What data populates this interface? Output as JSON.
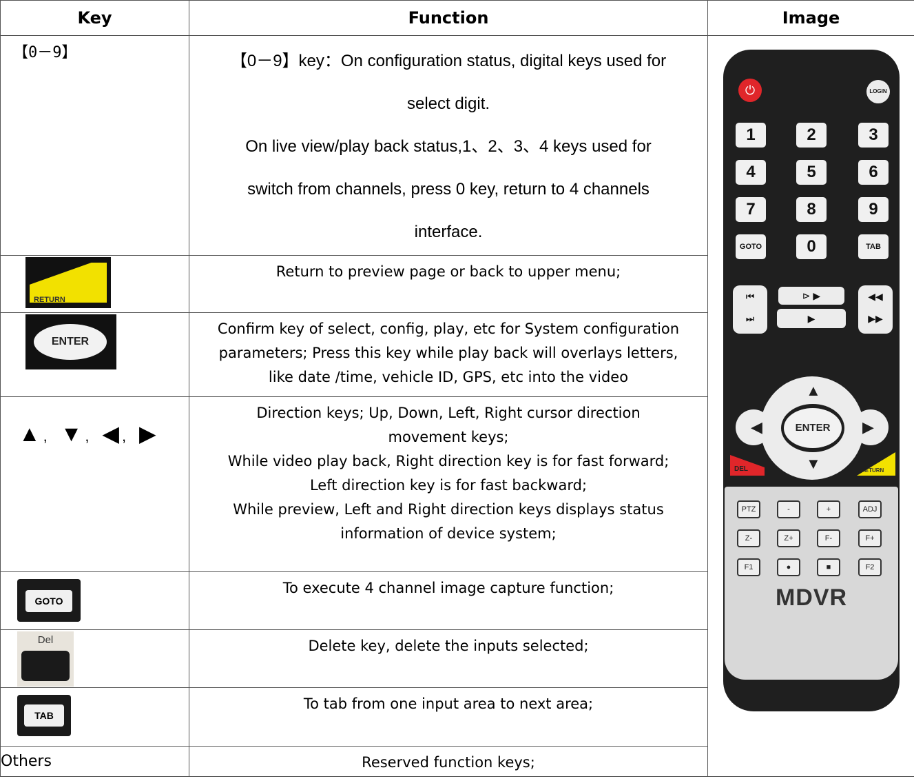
{
  "headers": {
    "key": "Key",
    "function": "Function",
    "image": "Image"
  },
  "rows": [
    {
      "key": "【0－9】",
      "lines": [
        "【0－9】key：On configuration status, digital keys used for",
        "select digit.",
        "On live view/play back status,1、2、3、4 keys used for",
        "switch from channels, press 0 key, return to 4 channels",
        "interface."
      ]
    },
    {
      "key_icon": "return-key",
      "key_icon_text": "RETURN",
      "lines": [
        "Return to preview page or back to upper menu;"
      ]
    },
    {
      "key_icon": "enter-key",
      "key_icon_text": "ENTER",
      "lines": [
        "Confirm key of select, config, play, etc for System configuration",
        "parameters; Press this key while play back will overlays letters,",
        "like date /time, vehicle ID, GPS, etc into the video"
      ]
    },
    {
      "arrows": [
        "▲",
        "▼",
        "◀",
        "▶"
      ],
      "lines": [
        "Direction keys; Up, Down, Left, Right cursor direction",
        "movement keys;",
        "While video play back, Right direction key is for fast forward;",
        "Left direction key is for fast backward;",
        "While preview, Left and Right direction keys displays status",
        "information of device system;"
      ]
    },
    {
      "key_icon": "goto-key",
      "key_icon_text": "GOTO",
      "lines": [
        "To execute 4 channel image capture function;"
      ]
    },
    {
      "key_icon": "del-key",
      "key_icon_text": "Del",
      "lines": [
        "Delete key, delete the inputs selected;"
      ]
    },
    {
      "key_icon": "tab-key",
      "key_icon_text": "TAB",
      "lines": [
        "To tab from one input area to next area;"
      ]
    },
    {
      "key": "Others",
      "lines": [
        "Reserved function keys;"
      ]
    }
  ],
  "remote": {
    "login": "LOGIN",
    "digits": [
      "1",
      "2",
      "3",
      "4",
      "5",
      "6",
      "7",
      "8",
      "9"
    ],
    "goto": "GOTO",
    "zero": "0",
    "tab": "TAB",
    "enter": "ENTER",
    "del": "DEL",
    "return": "RETURN",
    "pad_keys": [
      "PTZ",
      "-",
      "+",
      "ADJ",
      "Z-",
      "Z+",
      "F-",
      "F+",
      "F1",
      "●",
      "■",
      "F2"
    ],
    "brand": "MDVR"
  }
}
